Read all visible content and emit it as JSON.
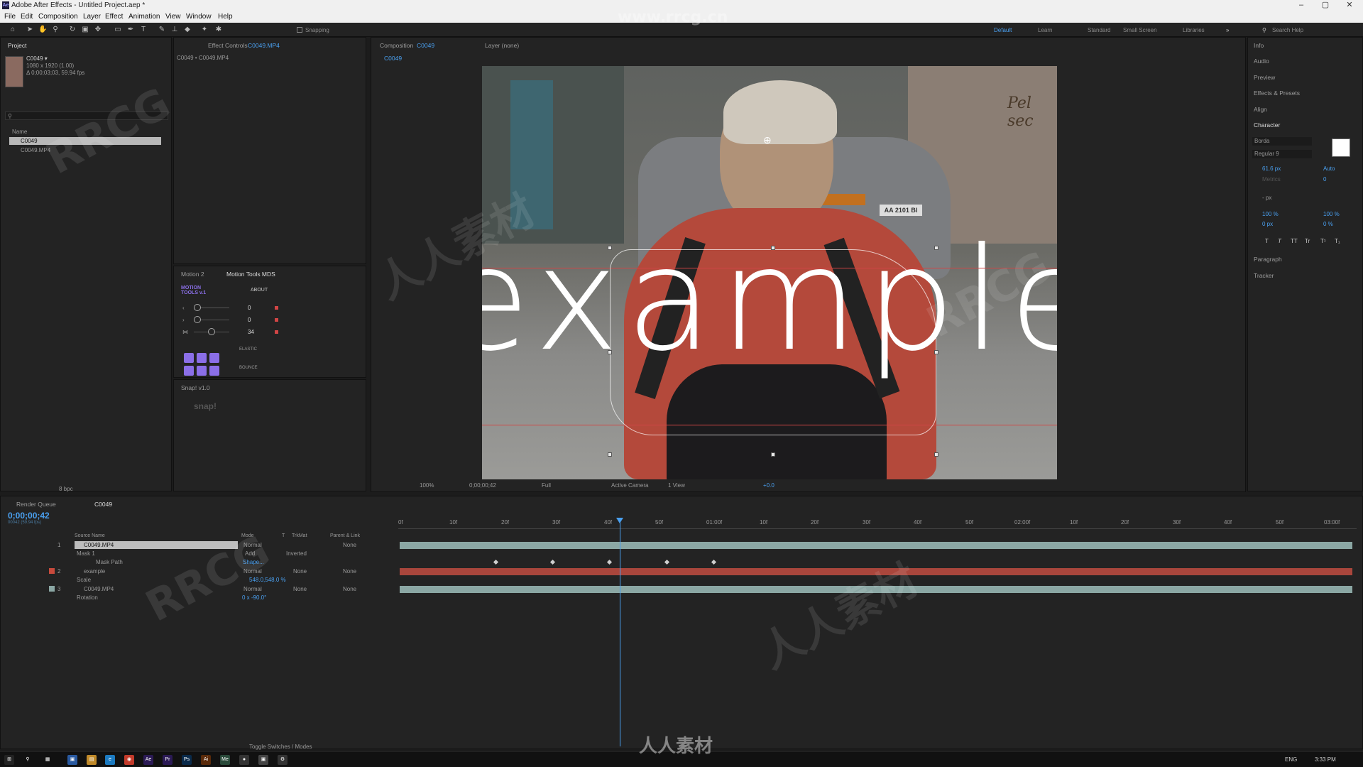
{
  "app": {
    "title": "Adobe After Effects - Untitled Project.aep *",
    "window_controls": {
      "minimize": "–",
      "maximize": "▢",
      "close": "✕"
    }
  },
  "menu": [
    "File",
    "Edit",
    "Composition",
    "Layer",
    "Effect",
    "Animation",
    "View",
    "Window",
    "Help"
  ],
  "toolbar": {
    "snapping_label": "Snapping",
    "workspaces": [
      "Default",
      "Learn",
      "Standard",
      "Small Screen",
      "Libraries"
    ],
    "search_help": "Search Help"
  },
  "project_panel": {
    "tab": "Project",
    "comp_name": "C0049 ▾",
    "comp_size": "1080 x 1920 (1.00)",
    "comp_duration": "Δ 0;00;03;03, 59.94 fps",
    "name_header": "Name",
    "items": [
      "C0049",
      "C0049.MP4"
    ],
    "bpc": "8 bpc"
  },
  "effect_controls": {
    "tab": "Effect Controls",
    "tab_target": "C0049.MP4",
    "path": "C0049 • C0049.MP4"
  },
  "motion_tools": {
    "tabs": [
      "Motion 2",
      "Motion Tools MDS"
    ],
    "logo": "MOTION TOOLS v.1",
    "about": "ABOUT",
    "sliders": [
      {
        "icon": "‹",
        "value": "0"
      },
      {
        "icon": "›",
        "value": "0"
      },
      {
        "icon": "⋈",
        "value": "34"
      }
    ],
    "elastic": "ELASTIC",
    "bounce": "BOUNCE",
    "snap_tab": "Snap! v1.0",
    "snap_logo": "snap!"
  },
  "composition": {
    "tab": "Composition",
    "tab_target": "C0049",
    "layer_tab": "Layer (none)",
    "breadcrumb": "C0049",
    "overlay_text": "example",
    "zoom": "100%",
    "timecode": "0;00;00;42",
    "resolution": "Full",
    "camera": "Active Camera",
    "views": "1 View",
    "exposure": "+0.0",
    "plate_text": "AA 2101 BI",
    "sign_text": "Pel sec"
  },
  "right_panel": {
    "tabs": [
      "Info",
      "Audio",
      "Preview",
      "Effects & Presets",
      "Align"
    ],
    "character_title": "Character",
    "font": "Borda",
    "style": "Regular 9",
    "font_size": "61.6 px",
    "leading": "Auto",
    "kerning": "Metrics",
    "tracking": "0",
    "stroke_unit": "- px",
    "vscale": "100 %",
    "hscale": "100 %",
    "baseline": "0 px",
    "tsume": "0 %",
    "styles": [
      "T",
      "T",
      "TT",
      "Tr",
      "T¹",
      "T₁"
    ],
    "paragraph": "Paragraph",
    "tracker": "Tracker"
  },
  "timeline": {
    "tabs": [
      "Render Queue",
      "C0049"
    ],
    "current_time": "0;00;00;42",
    "fps_sub": "00042 (59.94 fps)",
    "headers": {
      "source": "Source Name",
      "mode": "Mode",
      "t": "T",
      "trkmat": "TrkMat",
      "parent": "Parent & Link"
    },
    "ruler": [
      "0f",
      "10f",
      "20f",
      "30f",
      "40f",
      "50f",
      "01:00f",
      "10f",
      "20f",
      "30f",
      "40f",
      "50f",
      "02:00f",
      "10f",
      "20f",
      "30f",
      "40f",
      "50f",
      "03:00f"
    ],
    "layers": [
      {
        "num": "1",
        "name": "C0049.MP4",
        "mode": "Normal",
        "trkmat": "",
        "parent": "None"
      },
      {
        "num": "2",
        "name": "example",
        "mode": "Normal",
        "trkmat": "None",
        "parent": "None"
      },
      {
        "num": "3",
        "name": "C0049.MP4",
        "mode": "Normal",
        "trkmat": "None",
        "parent": "None"
      }
    ],
    "mask": {
      "name": "Mask 1",
      "mode": "Add",
      "inverted": "Inverted",
      "path_label": "Mask Path",
      "path_value": "Shape..."
    },
    "scale": {
      "label": "Scale",
      "value": "548.0,548.0 %"
    },
    "rotation": {
      "label": "Rotation",
      "value": "0 x -90.0°"
    },
    "toggle": "Toggle Switches / Modes"
  },
  "taskbar": {
    "lang": "ENG",
    "time": "3:33 PM"
  },
  "watermarks": {
    "site": "www.rrcg.cn",
    "brand": "RRCG",
    "cn": "人人素材",
    "bottom": "人人素材"
  },
  "colors": {
    "accent": "#2d8ceb",
    "layer_red": "#a9463c",
    "layer_teal": "#8ba7a4",
    "purple": "#8b6fe8"
  }
}
